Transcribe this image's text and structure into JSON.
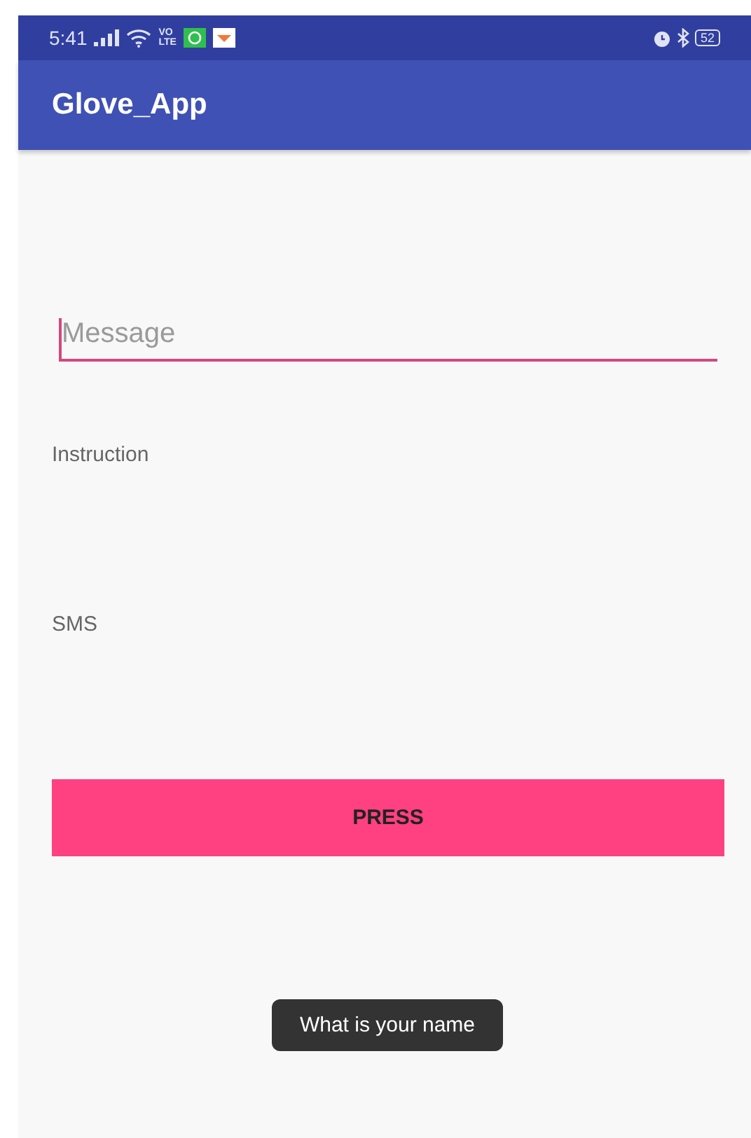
{
  "status_bar": {
    "time": "5:41",
    "network_label": [
      "VO",
      "LTE"
    ],
    "battery": "52"
  },
  "app_bar": {
    "title": "Glove_App"
  },
  "message_field": {
    "placeholder": "Message",
    "focused": true
  },
  "labels": [
    "Instruction",
    "SMS"
  ],
  "button": {
    "label": "PRESS"
  },
  "toast": {
    "text": "What is your name"
  }
}
